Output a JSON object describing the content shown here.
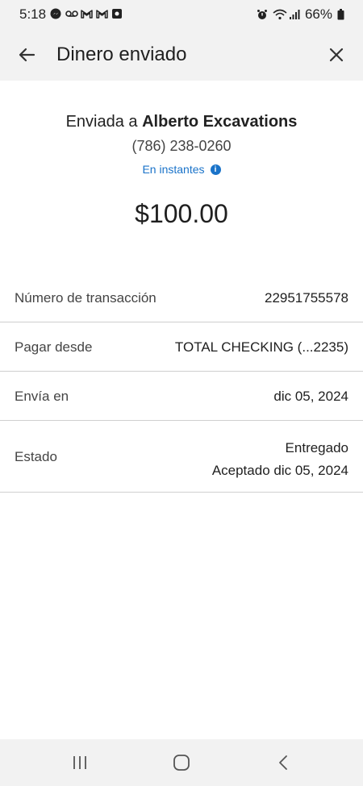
{
  "status_bar": {
    "time": "5:18",
    "battery": "66%",
    "icons": [
      "messenger-icon",
      "voicemail-icon",
      "gmail-icon",
      "gmail-icon",
      "app-icon",
      "alarm-icon",
      "wifi-icon",
      "signal-icon",
      "battery-icon"
    ]
  },
  "header": {
    "title": "Dinero enviado",
    "back_icon": "back-arrow-icon",
    "close_icon": "close-icon"
  },
  "summary": {
    "sent_prefix": "Enviada a ",
    "recipient": "Alberto Excavations",
    "phone": "(786) 238-0260",
    "speed": "En instantes",
    "amount": "$100.00",
    "accent_color": "#1a73c9"
  },
  "details": {
    "transaction_label": "Número de transacción",
    "transaction_value": "22951755578",
    "pay_from_label": "Pagar desde",
    "pay_from_value": "TOTAL CHECKING (...2235)",
    "send_on_label": "Envía en",
    "send_on_value": "dic 05, 2024",
    "status_label": "Estado",
    "status_value_1": "Entregado",
    "status_value_2": "Aceptado dic 05, 2024"
  },
  "navbar": {
    "icons": [
      "recent-apps-icon",
      "home-icon",
      "back-icon"
    ]
  }
}
